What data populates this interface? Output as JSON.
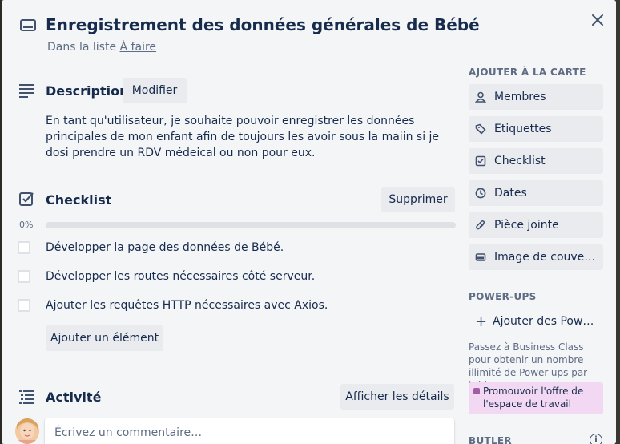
{
  "card": {
    "title": "Enregistrement des données générales de Bébé",
    "in_list_prefix": "Dans la liste",
    "list_name": "À faire"
  },
  "description": {
    "heading": "Description",
    "edit_label": "Modifier",
    "text": "En tant qu'utilisateur, je souhaite pouvoir enregistrer les données principales de mon enfant afin de toujours les avoir sous la maiin si je dosi prendre un RDV médeical ou non pour eux."
  },
  "checklist": {
    "heading": "Checklist",
    "delete_label": "Supprimer",
    "progress_text": "0%",
    "progress_value": 0,
    "items": [
      {
        "label": "Développer la page des données de Bébé.",
        "checked": false
      },
      {
        "label": "Développer les routes nécessaires côté serveur.",
        "checked": false
      },
      {
        "label": "Ajouter les requêtes HTTP nécessaires avec Axios.",
        "checked": false
      }
    ],
    "add_item_label": "Ajouter un élément"
  },
  "activity": {
    "heading": "Activité",
    "details_label": "Afficher les détails",
    "comment_placeholder": "Écrivez un commentaire…"
  },
  "sidebar": {
    "add_heading": "AJOUTER À LA CARTE",
    "buttons": [
      {
        "label": "Membres",
        "icon": "person-icon"
      },
      {
        "label": "Étiquettes",
        "icon": "tag-icon"
      },
      {
        "label": "Checklist",
        "icon": "checkbox-icon"
      },
      {
        "label": "Dates",
        "icon": "clock-icon"
      },
      {
        "label": "Pièce jointe",
        "icon": "paperclip-icon"
      },
      {
        "label": "Image de couverture",
        "icon": "cover-icon"
      }
    ],
    "powerups_heading": "POWER-UPS",
    "add_powerups_label": "Ajouter des Power-Ups",
    "powerups_note": "Passez à Business Class pour obtenir un nombre illimité de Power-ups par tableau.",
    "promo_label": "Promouvoir l'offre de l'espace de travail",
    "butler_heading": "BUTLER"
  },
  "colors": {
    "modal_bg": "#f4f5f7",
    "button_bg": "#e9ebee",
    "text": "#172b4d",
    "muted": "#5e6c84",
    "promo_bg": "#f3d8f3"
  }
}
